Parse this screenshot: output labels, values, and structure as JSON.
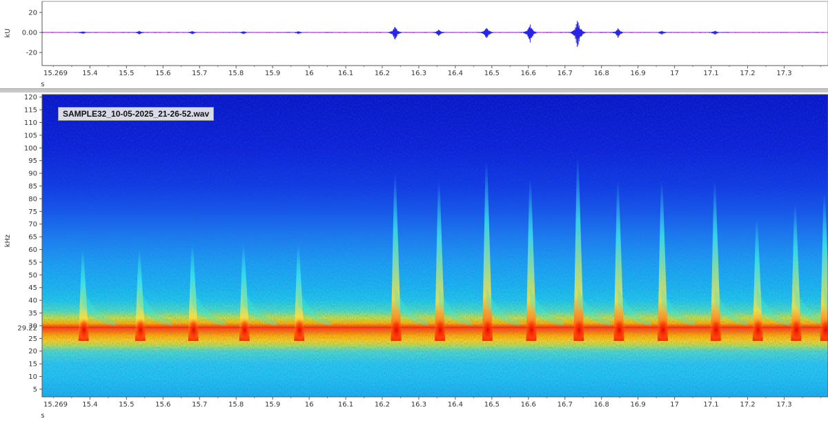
{
  "waveform": {
    "y_unit": "kU",
    "x_unit": "s",
    "y_ticks": [
      {
        "v": 20,
        "label": "20"
      },
      {
        "v": 0,
        "label": "0.00"
      },
      {
        "v": -20,
        "label": "-20"
      }
    ],
    "y_range": [
      -33,
      31
    ],
    "x_start_label": "15.269"
  },
  "spectrogram": {
    "y_unit": "kHz",
    "x_unit": "s",
    "y_ticks": [
      "5",
      "10",
      "15",
      "20",
      "25",
      "30",
      "35",
      "40",
      "45",
      "50",
      "55",
      "60",
      "65",
      "70",
      "75",
      "80",
      "85",
      "90",
      "95",
      "100",
      "105",
      "110",
      "115",
      "120"
    ],
    "y_range": [
      2,
      121
    ],
    "cursor_label": "29.22",
    "x_start_label": "15.269",
    "file_label": "SAMPLE32_10-05-2025_21-26-52.wav"
  },
  "x_axis": {
    "range": [
      15.269,
      17.42
    ],
    "tick_labels": [
      "15.4",
      "15.5",
      "15.6",
      "15.7",
      "15.8",
      "15.9",
      "16",
      "16.1",
      "16.2",
      "16.3",
      "16.4",
      "16.5",
      "16.6",
      "16.7",
      "16.8",
      "16.9",
      "17",
      "17.1",
      "17.2",
      "17.3"
    ]
  },
  "colors": {
    "waveform": "#2a23e8",
    "zero_line": "#cc00cc",
    "cursor_line": "#ff2200",
    "spec_low": "#0a1ad6",
    "spec_high": "#ff2000",
    "axis_label": "#1a1ad0"
  },
  "chart_data": [
    {
      "type": "line",
      "title": "",
      "xlabel": "s",
      "ylabel": "kU",
      "xlim": [
        15.269,
        17.42
      ],
      "ylim": [
        -33,
        31
      ],
      "grid": false,
      "series": [
        {
          "x": [
            15.38,
            15.535,
            15.68,
            15.82,
            15.97,
            16.235,
            16.355,
            16.485,
            16.605,
            16.735,
            16.845,
            16.965,
            17.11
          ],
          "values": [
            1.5,
            1.5,
            1.5,
            1.5,
            1.5,
            6,
            3,
            6,
            8,
            14,
            4,
            2,
            2
          ]
        }
      ]
    },
    {
      "type": "heatmap",
      "title": "SAMPLE32_10-05-2025_21-26-52.wav",
      "xlabel": "s",
      "ylabel": "kHz",
      "xlim": [
        15.269,
        17.42
      ],
      "ylim": [
        2,
        121
      ],
      "cursor_frequency_khz": 29.22,
      "grid": false,
      "calls": {
        "time_s": [
          15.38,
          15.535,
          15.68,
          15.82,
          15.97,
          16.235,
          16.355,
          16.485,
          16.605,
          16.735,
          16.845,
          16.965,
          17.11,
          17.225,
          17.33,
          17.41
        ],
        "top_freq_khz": [
          60,
          60,
          62,
          62,
          62,
          90,
          87,
          95,
          88,
          96,
          87,
          87,
          87,
          72,
          78,
          82
        ]
      }
    }
  ]
}
